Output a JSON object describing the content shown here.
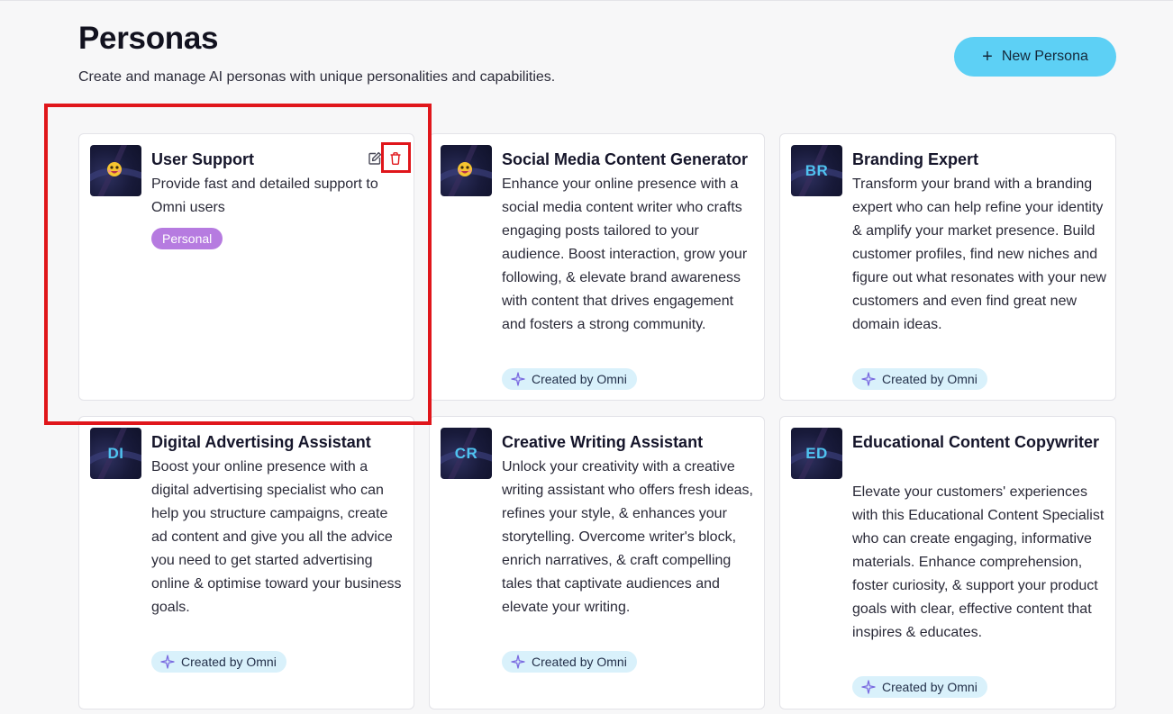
{
  "header": {
    "title": "Personas",
    "subtitle": "Create and manage AI personas with unique personalities and capabilities.",
    "new_button_label": "New Persona"
  },
  "badge_omni_label": "Created by Omni",
  "colors": {
    "accent": "#5dd0f5",
    "personal_badge": "#b67be0",
    "omni_badge": "#d9f1fb",
    "highlight": "#e0161b",
    "delete_icon": "#e0161b"
  },
  "personas": [
    {
      "title": "User Support",
      "description": "Provide fast and detailed support to Omni users",
      "badge": "Personal",
      "avatar": "emoji-icon"
    },
    {
      "title": "Social Media Content Generator",
      "description": "Enhance your online presence with a social media content writer who crafts engaging posts tailored to your audience. Boost interaction, grow your following, & elevate brand awareness with content that drives engagement and fosters a strong community.",
      "avatar": "emoji-icon"
    },
    {
      "title": "Branding Expert",
      "description": "Transform your brand with a branding expert who can help refine your identity & amplify your market presence. Build customer profiles, find new niches and figure out what resonates with your new customers and even find great new domain ideas.",
      "initials": "BR"
    },
    {
      "title": "Digital Advertising Assistant",
      "description": "Boost your online presence with a digital advertising specialist who can help you structure campaigns, create ad content and give you all the advice you need to get started advertising online & optimise toward your business goals.",
      "initials": "DI"
    },
    {
      "title": "Creative Writing Assistant",
      "description": "Unlock your creativity with a creative writing assistant who offers fresh ideas, refines your style, & enhances your storytelling. Overcome writer's block, enrich narratives, & craft compelling tales that captivate audiences and elevate your writing.",
      "initials": "CR"
    },
    {
      "title": "Educational Content Copywriter",
      "description": "Elevate your customers' experiences with this Educational Content Specialist who can create engaging, informative materials. Enhance comprehension, foster curiosity, & support your product goals with clear, effective content that inspires & educates.",
      "initials": "ED"
    }
  ]
}
